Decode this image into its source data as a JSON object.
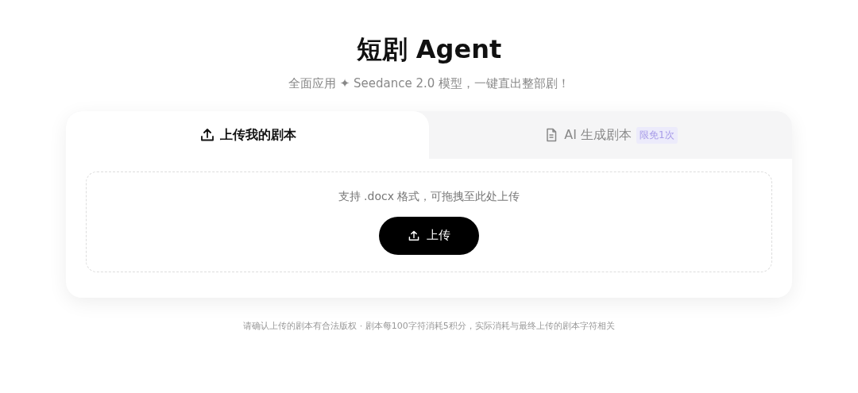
{
  "header": {
    "title": "短剧 Agent",
    "subtitle": "全面应用 ✦ Seedance 2.0 模型，一键直出整部剧！"
  },
  "tabs": [
    {
      "label": "上传我的剧本",
      "kind": "upload",
      "selected": true
    },
    {
      "label": "AI 生成剧本",
      "kind": "generate",
      "badge": "限免1次",
      "selected": false
    }
  ],
  "dropzone": {
    "hint": "支持 .docx 格式，可拖拽至此处上传",
    "button": "上传"
  },
  "footer_note": "请确认上传的剧本有合法版权 · 剧本每100字符消耗5积分，实际消耗与最终上传的剧本字符相关"
}
